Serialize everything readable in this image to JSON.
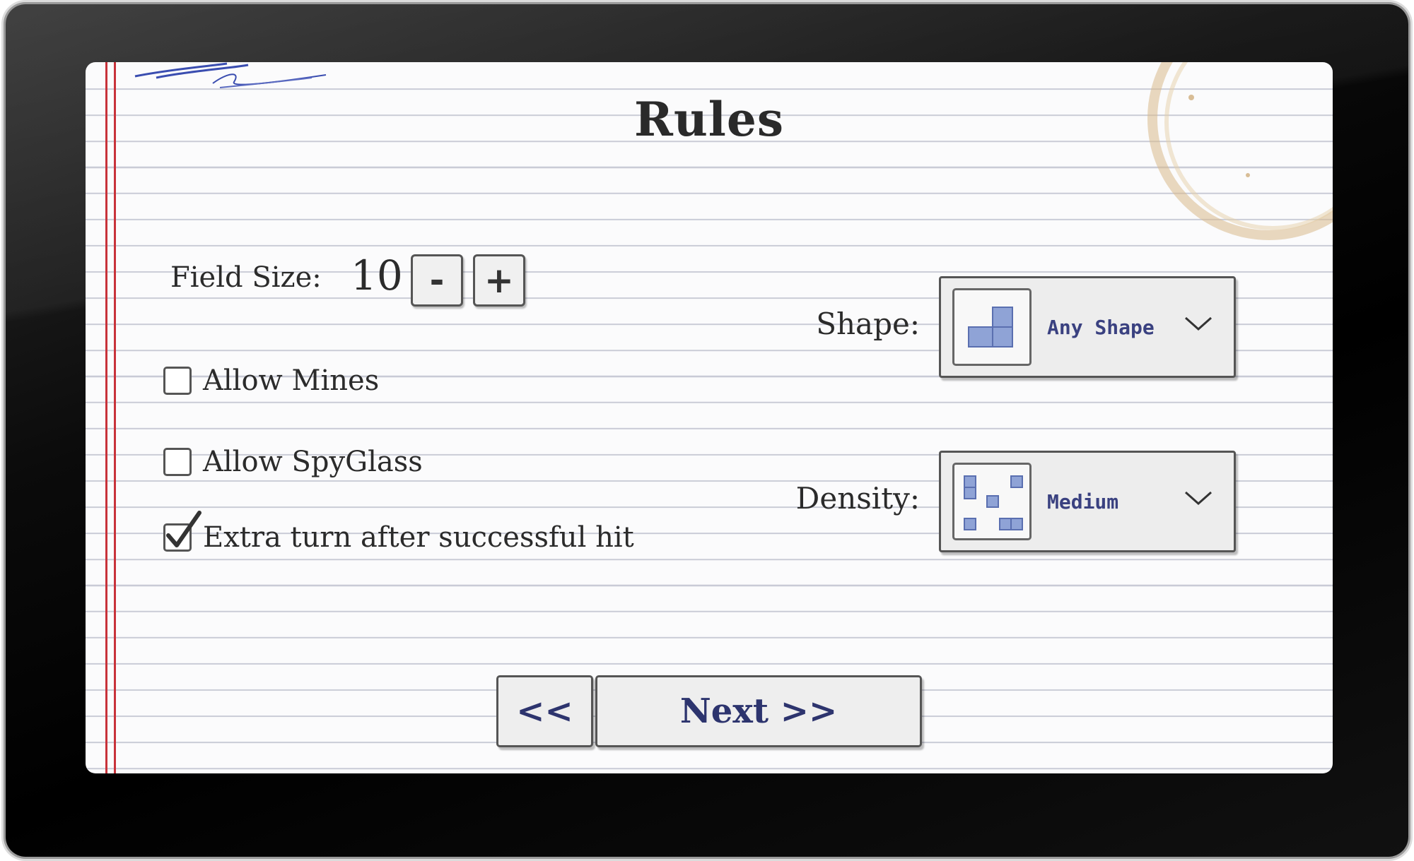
{
  "page": {
    "title": "Rules"
  },
  "field_size": {
    "label": "Field Size:",
    "value": "10",
    "decrement_label": "-",
    "increment_label": "+"
  },
  "options": [
    {
      "label": "Allow Mines",
      "checked": false
    },
    {
      "label": "Allow SpyGlass",
      "checked": false
    },
    {
      "label": "Extra turn after successful hit",
      "checked": true
    }
  ],
  "shape": {
    "label": "Shape:",
    "value": "Any Shape",
    "icon": "tetromino-icon"
  },
  "density": {
    "label": "Density:",
    "value": "Medium",
    "icon": "scatter-grid-icon"
  },
  "navigation": {
    "back_label": "<<",
    "next_label": "Next >>"
  },
  "colors": {
    "accent_text": "#3a4180",
    "margin_line": "#c8323a",
    "ruled_line": "#c9cbd6",
    "stain": "#d8b98a"
  }
}
